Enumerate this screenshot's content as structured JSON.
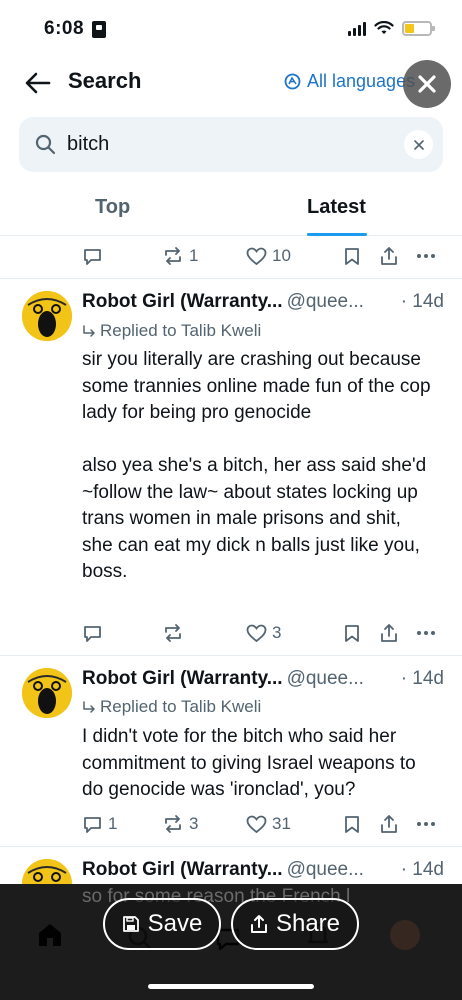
{
  "status_bar": {
    "time": "6:08"
  },
  "header": {
    "title": "Search",
    "language_label": "All languages"
  },
  "search": {
    "value": "bitch"
  },
  "tabs": [
    {
      "label": "Top"
    },
    {
      "label": "Latest"
    }
  ],
  "top_actions": {
    "reply_count": "",
    "repost_count": "1",
    "like_count": "10"
  },
  "posts": [
    {
      "display_name": "Robot Girl (Warranty...",
      "handle": "@quee...",
      "time": "· 14d",
      "replied_to": "Replied to Talib Kweli",
      "text": "sir you literally are crashing out because some trannies online made fun of the cop lady for being pro genocide\n\nalso yea she's a bitch, her ass said she'd ~follow the law~ about states locking up trans women in male prisons and shit, she can eat my dick n balls just like you, boss.",
      "reply_count": "",
      "repost_count": "",
      "like_count": "3"
    },
    {
      "display_name": "Robot Girl (Warranty...",
      "handle": "@quee...",
      "time": "· 14d",
      "replied_to": "Replied to Talib Kweli",
      "text": "I didn't vote for the bitch who said her commitment to giving Israel weapons to do genocide was 'ironclad', you?",
      "reply_count": "1",
      "repost_count": "3",
      "like_count": "31"
    },
    {
      "display_name": "Robot Girl (Warranty...",
      "handle": "@quee...",
      "time": "· 14d",
      "peek_text": "so for some reason the French l"
    }
  ],
  "overlay": {
    "save_label": "Save",
    "share_label": "Share"
  },
  "colors": {
    "accent": "#1d9bf0",
    "link": "#1d74c8",
    "muted": "#536471",
    "avatar": "#f2c418",
    "nav_bg": "#1c1c1c"
  }
}
